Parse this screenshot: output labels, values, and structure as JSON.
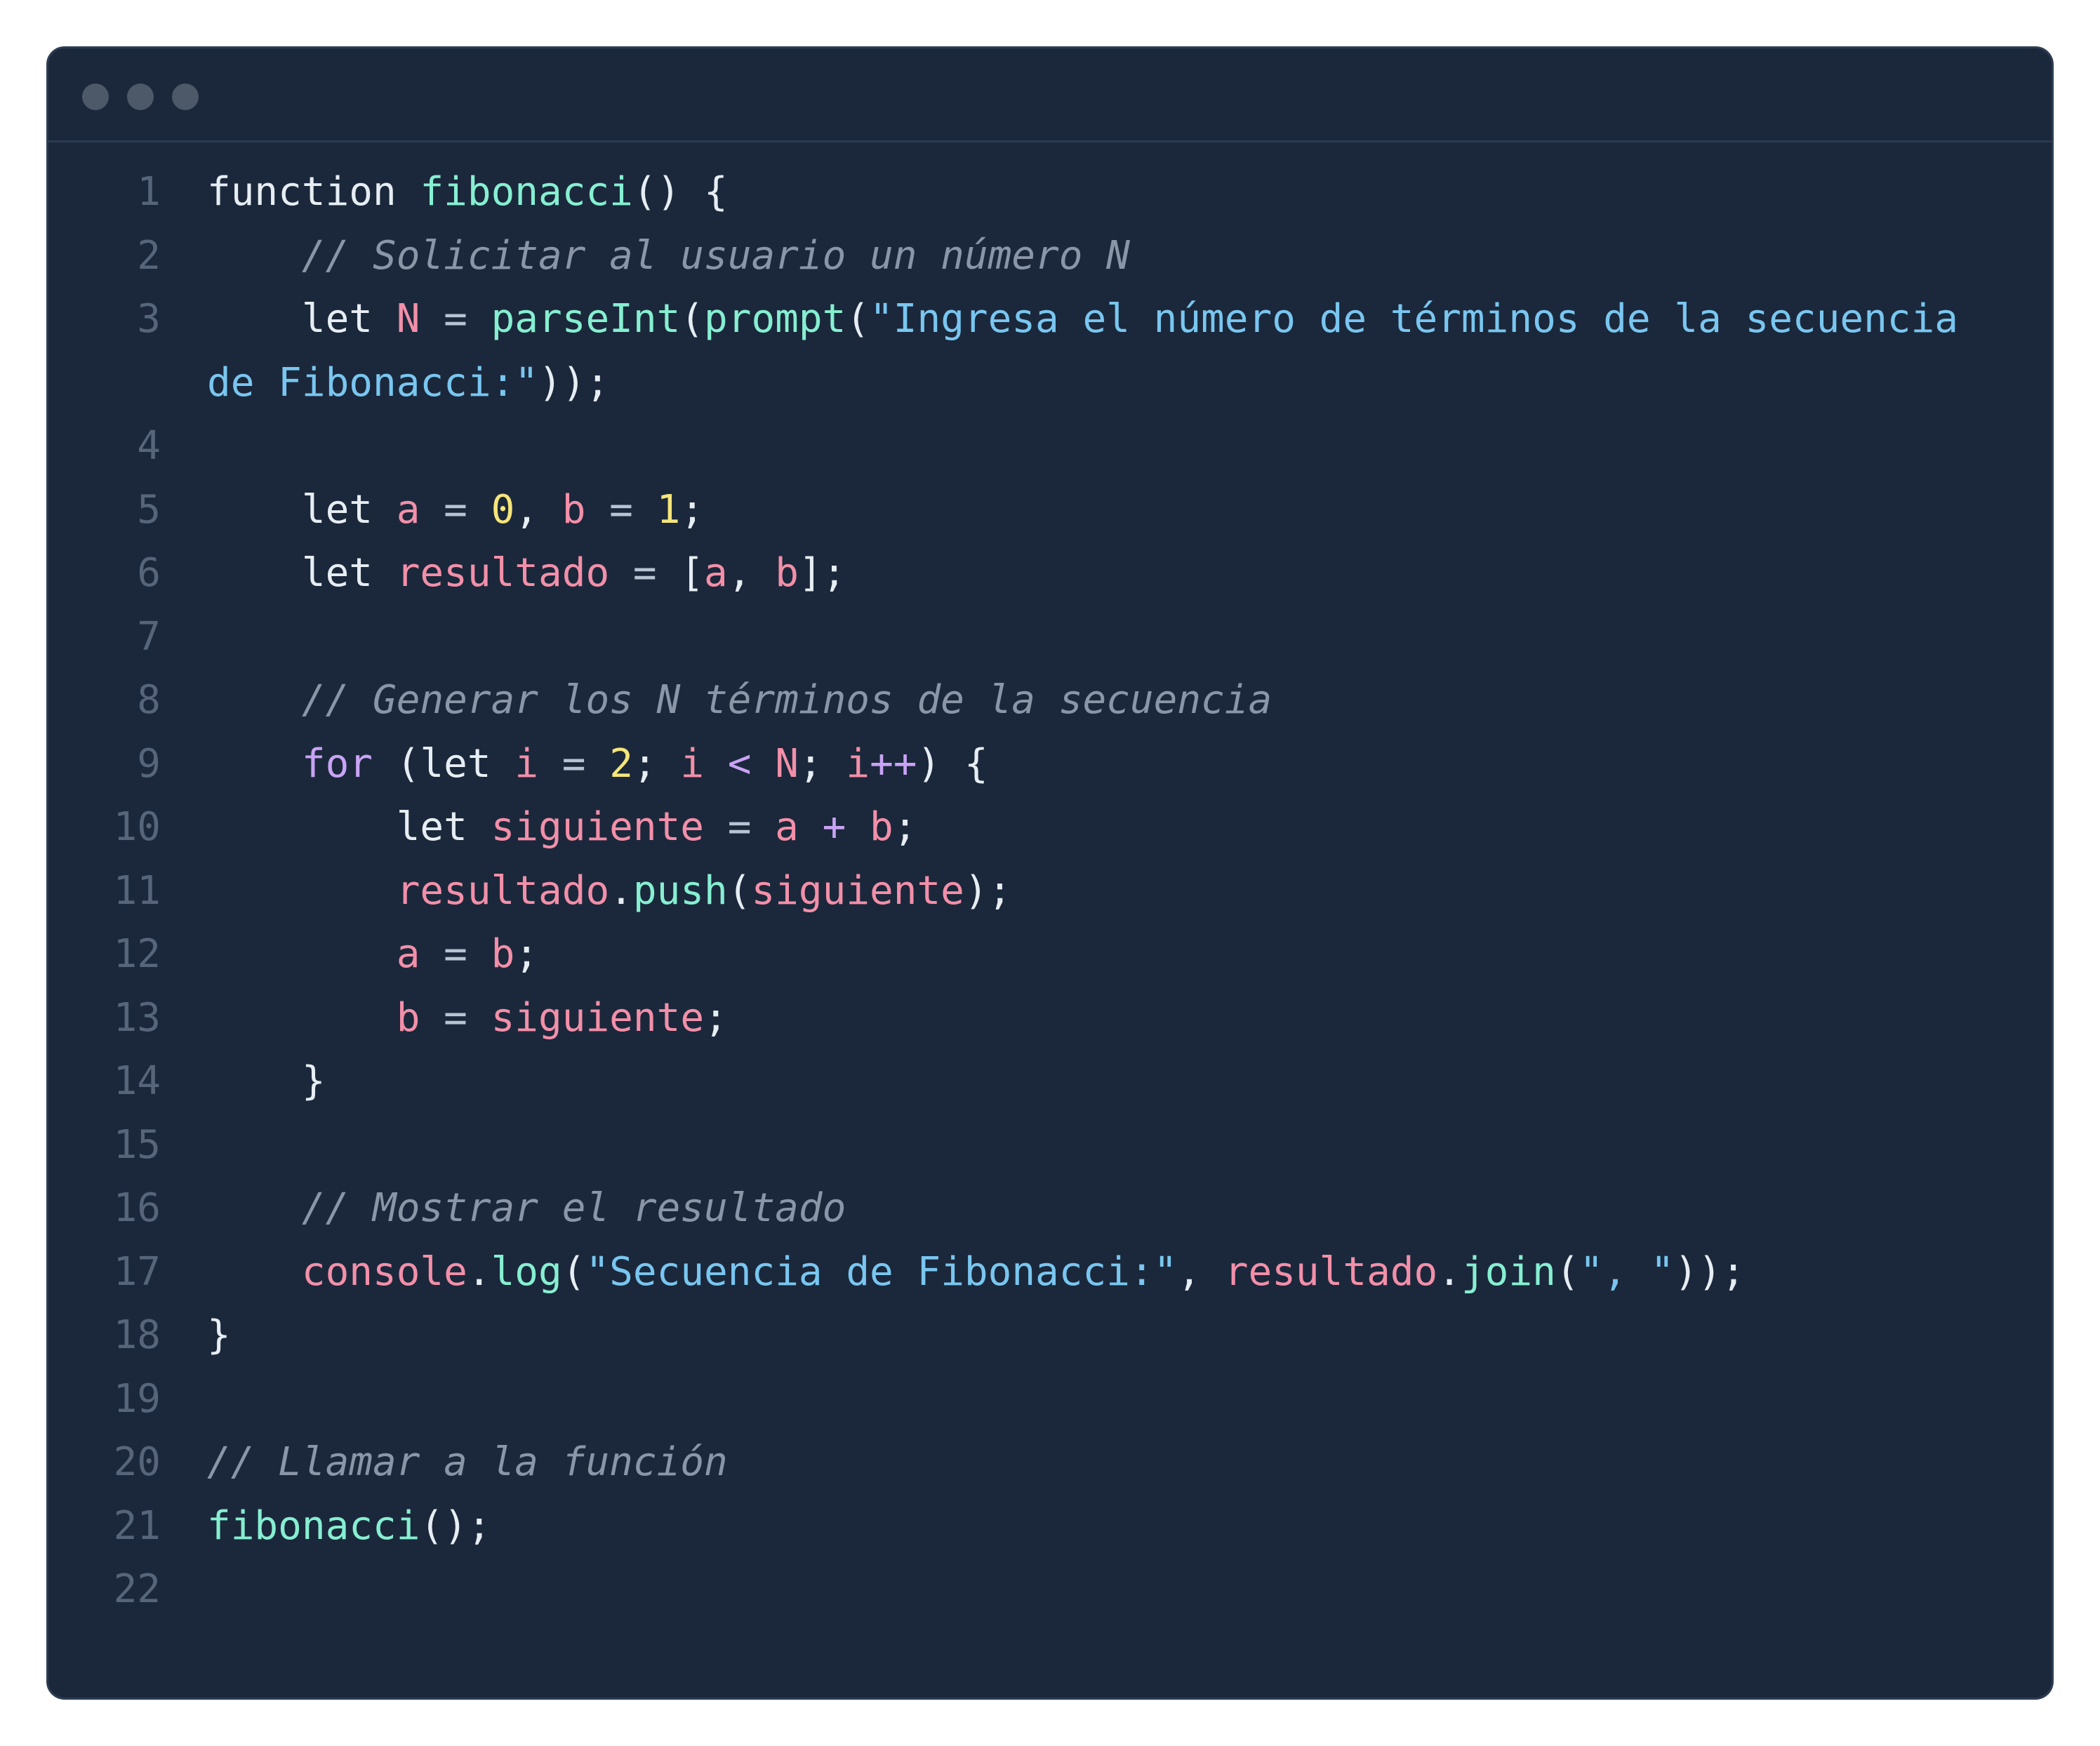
{
  "window": {
    "controls": [
      "window-dot",
      "window-dot",
      "window-dot"
    ]
  },
  "colors": {
    "background": "#1b283b",
    "plain": "#e6edf3",
    "function": "#86efd1",
    "variable": "#f38fa9",
    "number": "#f5e57a",
    "string": "#79c6f0",
    "keyword": "#c9a3f5",
    "comment": "#8a96a8",
    "line_number": "#56657a"
  },
  "code": {
    "lines": [
      {
        "n": "1",
        "tokens": [
          [
            "plain",
            "function "
          ],
          [
            "fn",
            "fibonacci"
          ],
          [
            "plain",
            "() {"
          ]
        ]
      },
      {
        "n": "2",
        "tokens": [
          [
            "plain",
            "    "
          ],
          [
            "cm",
            "// Solicitar al usuario un número N"
          ]
        ]
      },
      {
        "n": "3",
        "wrap": true,
        "tokens": [
          [
            "plain",
            "    let "
          ],
          [
            "var",
            "N"
          ],
          [
            "op",
            " = "
          ],
          [
            "fn",
            "parseInt"
          ],
          [
            "plain",
            "("
          ],
          [
            "fn",
            "prompt"
          ],
          [
            "plain",
            "("
          ],
          [
            "str",
            "\"Ingresa el número de términos de la secuencia de Fibonacci:\""
          ],
          [
            "plain",
            "));"
          ]
        ]
      },
      {
        "n": "4",
        "tokens": []
      },
      {
        "n": "5",
        "tokens": [
          [
            "plain",
            "    let "
          ],
          [
            "var",
            "a"
          ],
          [
            "op",
            " = "
          ],
          [
            "num",
            "0"
          ],
          [
            "plain",
            ", "
          ],
          [
            "var",
            "b"
          ],
          [
            "op",
            " = "
          ],
          [
            "num",
            "1"
          ],
          [
            "plain",
            ";"
          ]
        ]
      },
      {
        "n": "6",
        "tokens": [
          [
            "plain",
            "    let "
          ],
          [
            "var",
            "resultado"
          ],
          [
            "op",
            " = "
          ],
          [
            "plain",
            "["
          ],
          [
            "var",
            "a"
          ],
          [
            "plain",
            ", "
          ],
          [
            "var",
            "b"
          ],
          [
            "plain",
            "];"
          ]
        ]
      },
      {
        "n": "7",
        "tokens": []
      },
      {
        "n": "8",
        "tokens": [
          [
            "plain",
            "    "
          ],
          [
            "cm",
            "// Generar los N términos de la secuencia"
          ]
        ]
      },
      {
        "n": "9",
        "tokens": [
          [
            "plain",
            "    "
          ],
          [
            "kw",
            "for"
          ],
          [
            "plain",
            " (let "
          ],
          [
            "var",
            "i"
          ],
          [
            "op",
            " = "
          ],
          [
            "num",
            "2"
          ],
          [
            "plain",
            "; "
          ],
          [
            "var",
            "i"
          ],
          [
            "kw",
            " < "
          ],
          [
            "var",
            "N"
          ],
          [
            "plain",
            "; "
          ],
          [
            "var",
            "i"
          ],
          [
            "kw",
            "++"
          ],
          [
            "plain",
            ") {"
          ]
        ]
      },
      {
        "n": "10",
        "tokens": [
          [
            "plain",
            "        let "
          ],
          [
            "var",
            "siguiente"
          ],
          [
            "op",
            " = "
          ],
          [
            "var",
            "a"
          ],
          [
            "kw",
            " + "
          ],
          [
            "var",
            "b"
          ],
          [
            "plain",
            ";"
          ]
        ]
      },
      {
        "n": "11",
        "tokens": [
          [
            "plain",
            "        "
          ],
          [
            "var",
            "resultado"
          ],
          [
            "plain",
            "."
          ],
          [
            "fn",
            "push"
          ],
          [
            "plain",
            "("
          ],
          [
            "var",
            "siguiente"
          ],
          [
            "plain",
            ");"
          ]
        ]
      },
      {
        "n": "12",
        "tokens": [
          [
            "plain",
            "        "
          ],
          [
            "var",
            "a"
          ],
          [
            "op",
            " = "
          ],
          [
            "var",
            "b"
          ],
          [
            "plain",
            ";"
          ]
        ]
      },
      {
        "n": "13",
        "tokens": [
          [
            "plain",
            "        "
          ],
          [
            "var",
            "b"
          ],
          [
            "op",
            " = "
          ],
          [
            "var",
            "siguiente"
          ],
          [
            "plain",
            ";"
          ]
        ]
      },
      {
        "n": "14",
        "tokens": [
          [
            "plain",
            "    }"
          ]
        ]
      },
      {
        "n": "15",
        "tokens": []
      },
      {
        "n": "16",
        "tokens": [
          [
            "plain",
            "    "
          ],
          [
            "cm",
            "// Mostrar el resultado"
          ]
        ]
      },
      {
        "n": "17",
        "tokens": [
          [
            "plain",
            "    "
          ],
          [
            "var",
            "console"
          ],
          [
            "plain",
            "."
          ],
          [
            "fn",
            "log"
          ],
          [
            "plain",
            "("
          ],
          [
            "str",
            "\"Secuencia de Fibonacci:\""
          ],
          [
            "plain",
            ", "
          ],
          [
            "var",
            "resultado"
          ],
          [
            "plain",
            "."
          ],
          [
            "fn",
            "join"
          ],
          [
            "plain",
            "("
          ],
          [
            "str",
            "\", \""
          ],
          [
            "plain",
            "));"
          ]
        ]
      },
      {
        "n": "18",
        "tokens": [
          [
            "plain",
            "}"
          ]
        ]
      },
      {
        "n": "19",
        "tokens": []
      },
      {
        "n": "20",
        "tokens": [
          [
            "cm",
            "// Llamar a la función"
          ]
        ]
      },
      {
        "n": "21",
        "tokens": [
          [
            "fn",
            "fibonacci"
          ],
          [
            "plain",
            "();"
          ]
        ]
      },
      {
        "n": "22",
        "tokens": []
      }
    ]
  }
}
